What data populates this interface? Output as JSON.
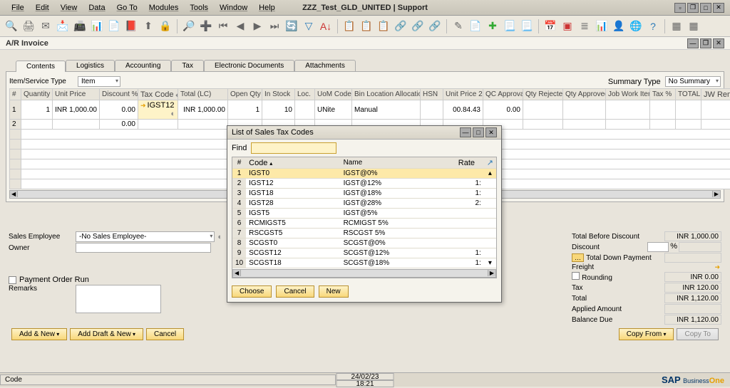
{
  "menubar": {
    "items": [
      "File",
      "Edit",
      "View",
      "Data",
      "Go To",
      "Modules",
      "Tools",
      "Window",
      "Help"
    ],
    "title": "ZZZ_Test_GLD_UNITED | Support"
  },
  "doc": {
    "title": "A/R Invoice"
  },
  "tabs": [
    "Contents",
    "Logistics",
    "Accounting",
    "Tax",
    "Electronic Documents",
    "Attachments"
  ],
  "leftForm": {
    "typeLabel": "Item/Service Type",
    "typeValue": "Item"
  },
  "rightForm": {
    "summaryLabel": "Summary Type",
    "summaryValue": "No Summary"
  },
  "grid": {
    "cols": [
      "#",
      "Quantity",
      "Unit Price",
      "Discount %",
      "Tax Code",
      "Total (LC)",
      "Open Qty",
      "In Stock",
      "Loc.",
      "UoM Code",
      "Bin Location Allocation",
      "HSN",
      "Unit Price 2",
      "QC Approval",
      "Qty Rejected",
      "Qty Approved",
      "Job Work Item",
      "Tax %",
      "TOTAL",
      "JW Remarks"
    ],
    "rows": [
      {
        "n": "1",
        "qty": "1",
        "unit": "INR 1,000.00",
        "disc": "0.00",
        "tax": "IGST12",
        "total": "INR 1,000.00",
        "open": "1",
        "stock": "10",
        "loc": "",
        "uom": "UNite",
        "bin": "Manual",
        "hsn": "",
        "up2": "00.84.43",
        "qc": "0.00"
      },
      {
        "n": "2",
        "qty": "",
        "unit": "",
        "disc": "0.00",
        "tax": "",
        "total": "",
        "open": "",
        "stock": "",
        "loc": "",
        "uom": "",
        "bin": "",
        "hsn": "",
        "up2": "",
        "qc": ""
      }
    ]
  },
  "salesEmpLabel": "Sales Employee",
  "salesEmpValue": "-No Sales Employee-",
  "ownerLabel": "Owner",
  "payOrderLabel": "Payment Order Run",
  "remarksLabel": "Remarks",
  "summary": {
    "beforeDisc": {
      "label": "Total Before Discount",
      "val": "INR 1,000.00"
    },
    "discount": {
      "label": "Discount",
      "pct": "%"
    },
    "downPay": {
      "label": "Total Down Payment"
    },
    "freight": {
      "label": "Freight"
    },
    "rounding": {
      "label": "Rounding",
      "val": "INR 0.00"
    },
    "tax": {
      "label": "Tax",
      "val": "INR 120.00"
    },
    "total": {
      "label": "Total",
      "val": "INR 1,120.00"
    },
    "applied": {
      "label": "Applied Amount"
    },
    "balance": {
      "label": "Balance Due",
      "val": "INR 1,120.00"
    }
  },
  "buttons": {
    "addNew": "Add & New",
    "addDraft": "Add Draft & New",
    "cancel": "Cancel",
    "copyFrom": "Copy From",
    "copyTo": "Copy To"
  },
  "status": {
    "codeLabel": "Code",
    "date": "24/02/23",
    "time": "18:21"
  },
  "modal": {
    "title": "List of Sales Tax Codes",
    "findLabel": "Find",
    "cols": [
      "#",
      "Code",
      "Name",
      "Rate"
    ],
    "rows": [
      {
        "n": "1",
        "code": "IGST0",
        "name": "IGST@0%",
        "rate": ""
      },
      {
        "n": "2",
        "code": "IGST12",
        "name": "IGST@12%",
        "rate": "1:"
      },
      {
        "n": "3",
        "code": "IGST18",
        "name": "IGST@18%",
        "rate": "1:"
      },
      {
        "n": "4",
        "code": "IGST28",
        "name": "IGST@28%",
        "rate": "2:"
      },
      {
        "n": "5",
        "code": "IGST5",
        "name": "IGST@5%",
        "rate": ""
      },
      {
        "n": "6",
        "code": "RCMIGST5",
        "name": "RCMIGST 5%",
        "rate": ""
      },
      {
        "n": "7",
        "code": "RSCGST5",
        "name": "RSCGST 5%",
        "rate": ""
      },
      {
        "n": "8",
        "code": "SCGST0",
        "name": "SCGST@0%",
        "rate": ""
      },
      {
        "n": "9",
        "code": "SCGST12",
        "name": "SCGST@12%",
        "rate": "1:"
      },
      {
        "n": "10",
        "code": "SCGST18",
        "name": "SCGST@18%",
        "rate": "1:"
      }
    ],
    "choose": "Choose",
    "cancel": "Cancel",
    "new": "New"
  }
}
